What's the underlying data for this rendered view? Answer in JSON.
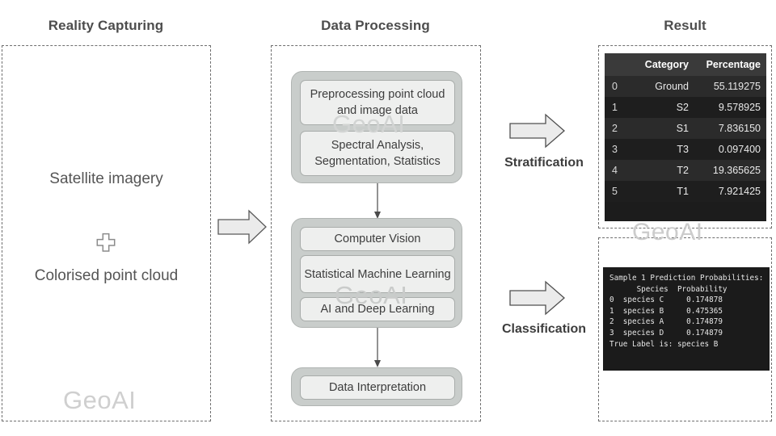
{
  "columns": {
    "reality": {
      "title": "Reality Capturing",
      "item_1": "Satellite imagery",
      "plus_icon": "plus-icon",
      "item_2": "Colorised point cloud",
      "watermark": "GeoAI"
    },
    "processing": {
      "title": "Data Processing",
      "watermark_top": "GeoAI",
      "watermark_bottom": "GeoAI",
      "group_1": {
        "box_1": "Preprocessing point cloud and image data",
        "box_2": "Spectral Analysis, Segmentation, Statistics"
      },
      "group_2": {
        "box_1": "Computer Vision",
        "box_2": "Statistical Machine Learning",
        "box_3": "AI and Deep Learning"
      },
      "group_3": {
        "box_1": "Data Interpretation"
      }
    },
    "result": {
      "title": "Result",
      "watermark": "GeoAI"
    }
  },
  "arrows": {
    "input_to_processing": "block-arrow-right",
    "stratification": {
      "icon": "block-arrow-right",
      "label": "Stratification"
    },
    "classification": {
      "icon": "block-arrow-right",
      "label": "Classification"
    },
    "connector_1": "down-arrow",
    "connector_2": "down-arrow",
    "connector_3": "down-arrow"
  },
  "result_table": {
    "headers": [
      "",
      "Category",
      "Percentage"
    ],
    "rows": [
      {
        "index": "0",
        "category": "Ground",
        "percentage": "55.119275"
      },
      {
        "index": "1",
        "category": "S2",
        "percentage": "9.578925"
      },
      {
        "index": "2",
        "category": "S1",
        "percentage": "7.836150"
      },
      {
        "index": "3",
        "category": "T3",
        "percentage": "0.097400"
      },
      {
        "index": "4",
        "category": "T2",
        "percentage": "19.365625"
      },
      {
        "index": "5",
        "category": "T1",
        "percentage": "7.921425"
      }
    ]
  },
  "terminal_output": {
    "lines": [
      "Sample 1 Prediction Probabilities:",
      "      Species  Probability",
      "0  species C     0.174878",
      "1  species B     0.475365",
      "2  species A     0.174879",
      "3  species D     0.174879",
      "True Label is: species B"
    ],
    "text": "Sample 1 Prediction Probabilities:\n      Species  Probability\n0  species C     0.174878\n1  species B     0.475365\n2  species A     0.174879\n3  species D     0.174879\nTrue Label is: species B"
  },
  "colors": {
    "group_fill": "#c9cdcb",
    "inner_fill": "#eeefee",
    "dashed_border": "#6e6e6e",
    "watermark": "#cfcfcf",
    "table_bg": "#1c1c1c",
    "table_header_bg": "#3a3a3a",
    "terminal_bg": "#1b1b1b",
    "title_text": "#4d4d4d"
  }
}
